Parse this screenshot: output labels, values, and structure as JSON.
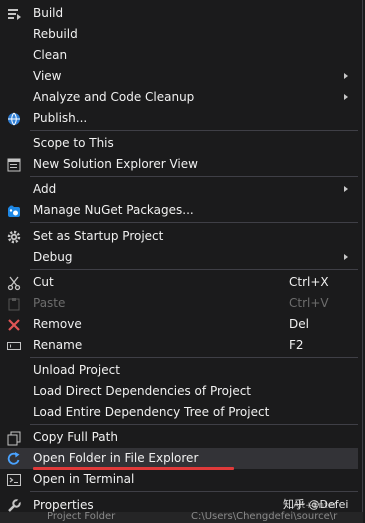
{
  "menu": {
    "build": "Build",
    "rebuild": "Rebuild",
    "clean": "Clean",
    "view": "View",
    "analyze": "Analyze and Code Cleanup",
    "publish": "Publish...",
    "scope": "Scope to This",
    "new_view": "New Solution Explorer View",
    "add": "Add",
    "nuget": "Manage NuGet Packages...",
    "startup": "Set as Startup Project",
    "debug": "Debug",
    "cut": "Cut",
    "cut_shortcut": "Ctrl+X",
    "paste": "Paste",
    "paste_shortcut": "Ctrl+V",
    "remove": "Remove",
    "remove_shortcut": "Del",
    "rename": "Rename",
    "rename_shortcut": "F2",
    "unload": "Unload Project",
    "load_direct": "Load Direct Dependencies of Project",
    "load_tree": "Load Entire Dependency Tree of Project",
    "copy_path": "Copy Full Path",
    "open_folder": "Open Folder in File Explorer",
    "open_terminal": "Open in Terminal",
    "properties": "Properties"
  },
  "background": {
    "folder_label": "Project Folder",
    "folder_path": "C:\\Users\\Chengdefei\\source\\r",
    "alt_enter": "Alt+Enter"
  },
  "watermark": {
    "text": "知乎 @Defei"
  },
  "colors": {
    "menu_bg": "#1b1b1c",
    "highlight": "#333337",
    "annotation_underline": "#e03a3a"
  }
}
